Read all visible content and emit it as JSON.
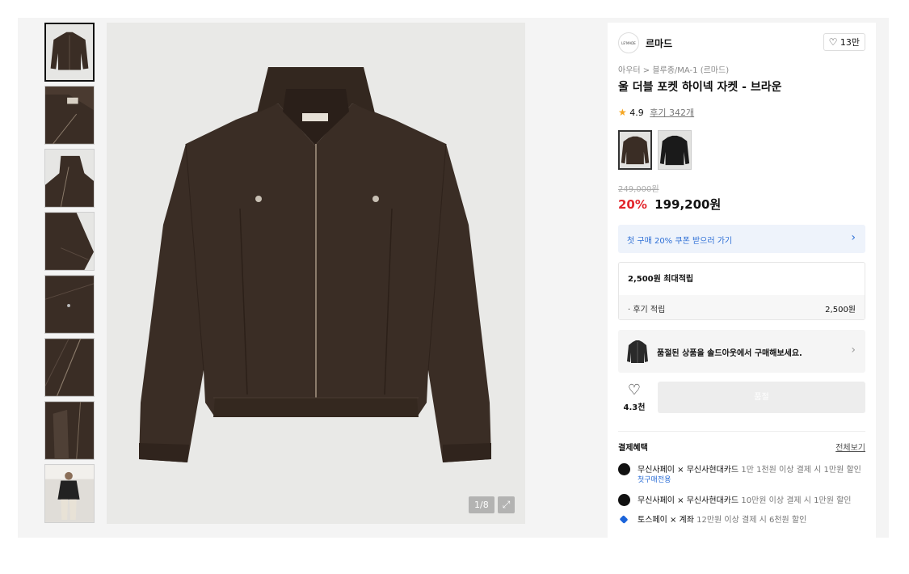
{
  "gallery": {
    "thumbnails": [
      {
        "view": "front"
      },
      {
        "view": "collar"
      },
      {
        "view": "collar-side"
      },
      {
        "view": "sleeve"
      },
      {
        "view": "pocket"
      },
      {
        "view": "zipper"
      },
      {
        "view": "hem"
      },
      {
        "view": "model"
      }
    ],
    "pager": "1/8",
    "expand_icon": "expand-icon"
  },
  "brand": {
    "logo_text": "LE'MADE",
    "name": "르마드",
    "like_icon": "heart-icon",
    "like_count": "13만"
  },
  "product": {
    "breadcrumb": "아우터 > 블루종/MA-1 (르마드)",
    "title": "울 더블 포켓 하이넥 자켓 - 브라운",
    "rating": "4.9",
    "review_link": "후기 342개",
    "original_price": "249,000원",
    "discount": "20%",
    "price": "199,200원"
  },
  "color_options": [
    {
      "name": "brown",
      "color": "#3b2f28"
    },
    {
      "name": "black",
      "color": "#1a1a1a"
    }
  ],
  "coupon": {
    "text": "첫 구매 20% 쿠폰 받으러 가기",
    "arrow_icon": "chevron-right-icon"
  },
  "points": {
    "title": "2,500원 최대적립",
    "row_label": "· 후기 적립",
    "row_value": "2,500원"
  },
  "soldout": {
    "text": "품절된 상품을 솔드아웃에서 구매해보세요.",
    "arrow_icon": "chevron-right-icon"
  },
  "actions": {
    "wish_count": "4.3천",
    "buy_label": "품절"
  },
  "benefits": {
    "title": "결제혜택",
    "see_all": "전체보기",
    "items": [
      {
        "provider": "무신사페이 × 무신사현대카드",
        "desc": "1만 1천원 이상 결제 시 1만원 할인",
        "tag": "첫구매전용"
      },
      {
        "provider": "무신사페이 × 무신사현대카드",
        "desc": "10만원 이상 결제 시 1만원 할인",
        "tag": ""
      },
      {
        "provider": "토스페이 × 계좌",
        "desc": "12만원 이상 결제 시 6천원 할인",
        "tag": ""
      }
    ]
  },
  "colors": {
    "jacket": "#3a2d25",
    "accent_red": "#e2262c",
    "accent_blue": "#2d6fd6"
  }
}
